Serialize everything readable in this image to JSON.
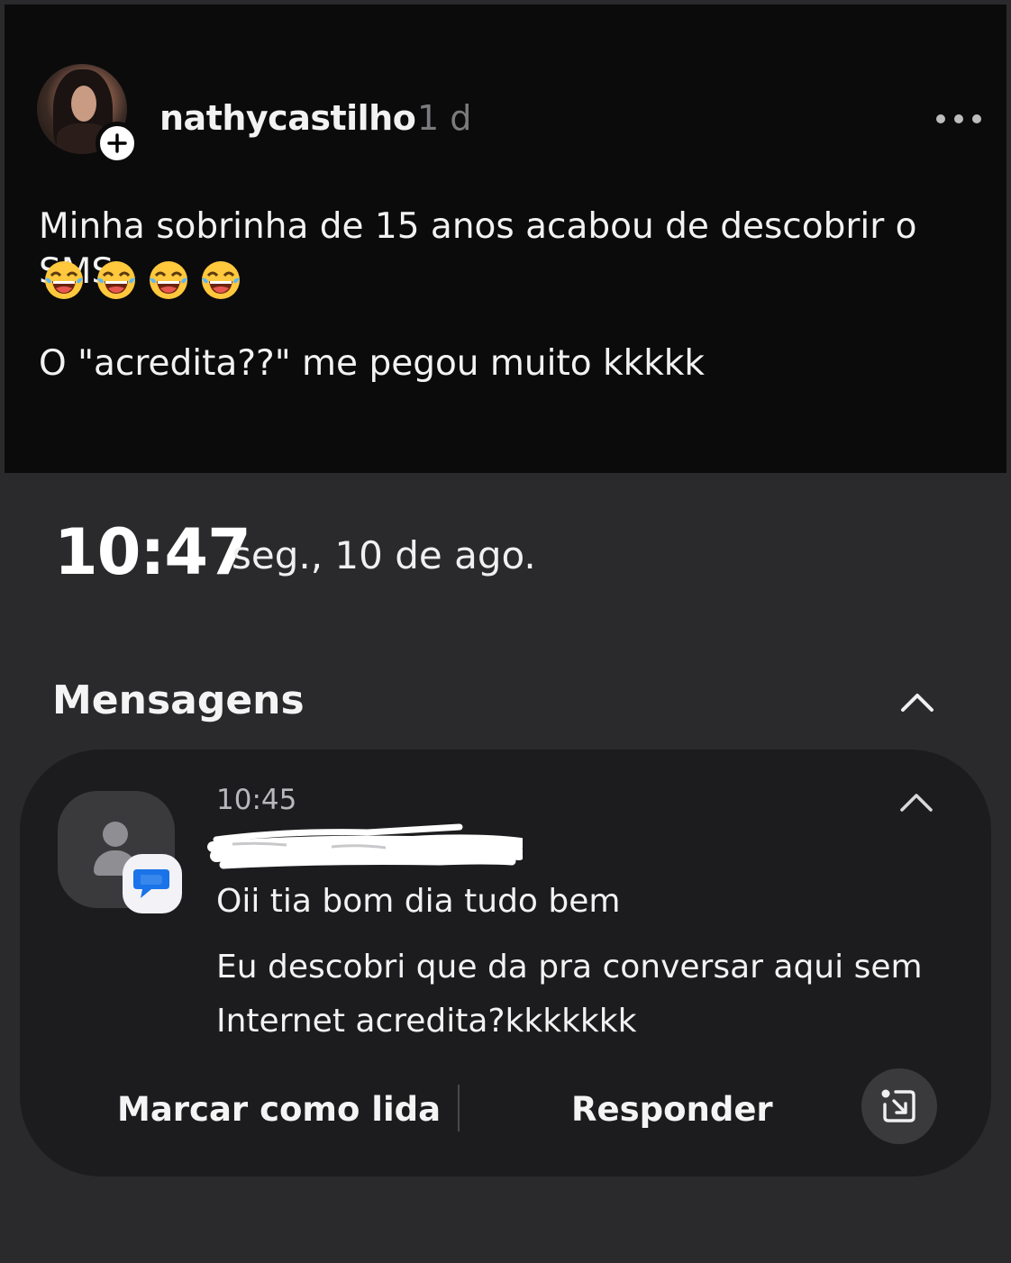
{
  "post": {
    "username": "nathycastilho",
    "time_ago": "1 d",
    "text_line1": "Minha sobrinha de 15 anos acabou de descobrir o SMS",
    "emojis": [
      "😂",
      "😂",
      "😂",
      "😂"
    ],
    "text_line2": "O \"acredita??\" me pegou muito kkkkk"
  },
  "lockscreen": {
    "time": "10:47",
    "date": "seg., 10 de ago."
  },
  "notifications": {
    "section_title": "Mensagens",
    "items": [
      {
        "app": "Mensagens",
        "time": "10:45",
        "sender_redacted": true,
        "message_line1": "Oii tia bom dia tudo bem",
        "message_line2": "Eu descobri que da pra conversar aqui sem Internet acredita?kkkkkkk",
        "actions": {
          "mark_read": "Marcar como lida",
          "reply": "Responder"
        }
      }
    ]
  },
  "colors": {
    "post_background": "#0b0b0c",
    "lockscreen_background": "#2a2a2c",
    "card_background": "#1c1c1e",
    "messages_blue": "#1a73e8"
  }
}
